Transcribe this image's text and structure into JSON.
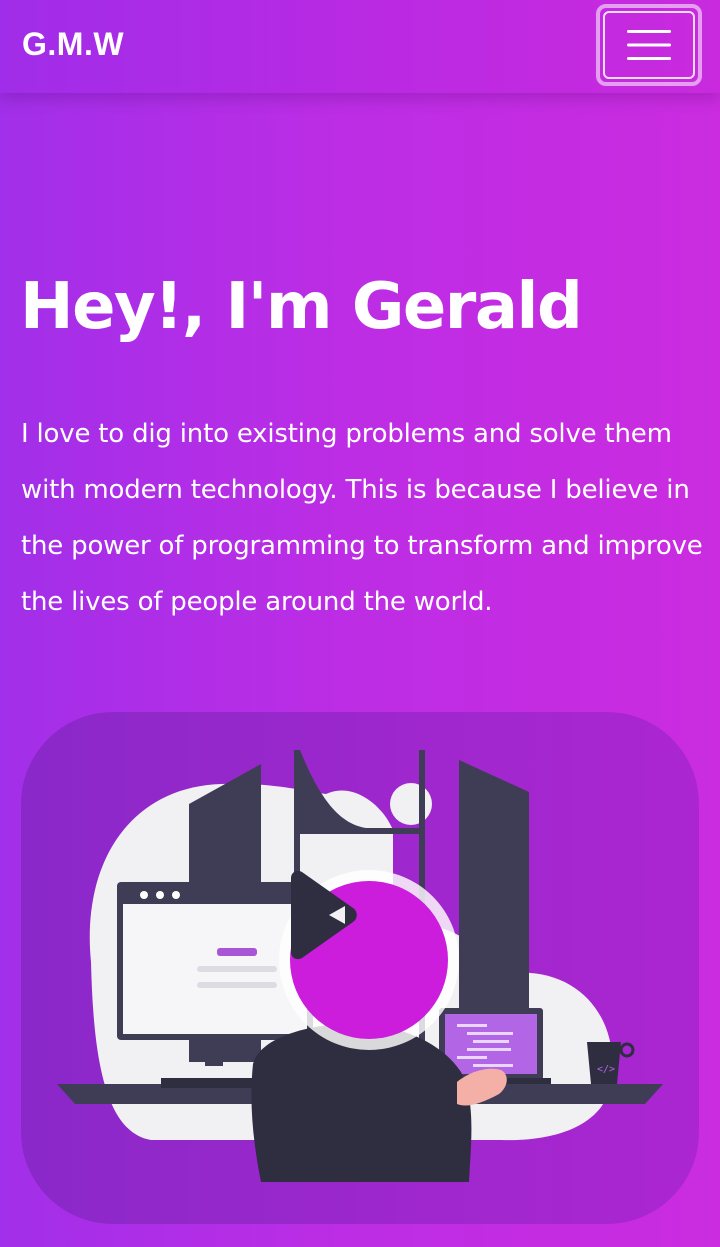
{
  "navbar": {
    "brand": "G.M.W",
    "menu_icon": "hamburger-menu-icon"
  },
  "hero": {
    "title": "Hey!, I'm Gerald",
    "description": "I love to dig into existing problems and solve them with modern technology. This is because I believe in the power of programming to transform and improve the lives of people around the world."
  },
  "illustration": {
    "play_icon": "play-icon"
  },
  "colors": {
    "gradient_start": "#a22fe9",
    "gradient_end": "#cb2ce0",
    "play_accent": "#cc1ddd"
  }
}
